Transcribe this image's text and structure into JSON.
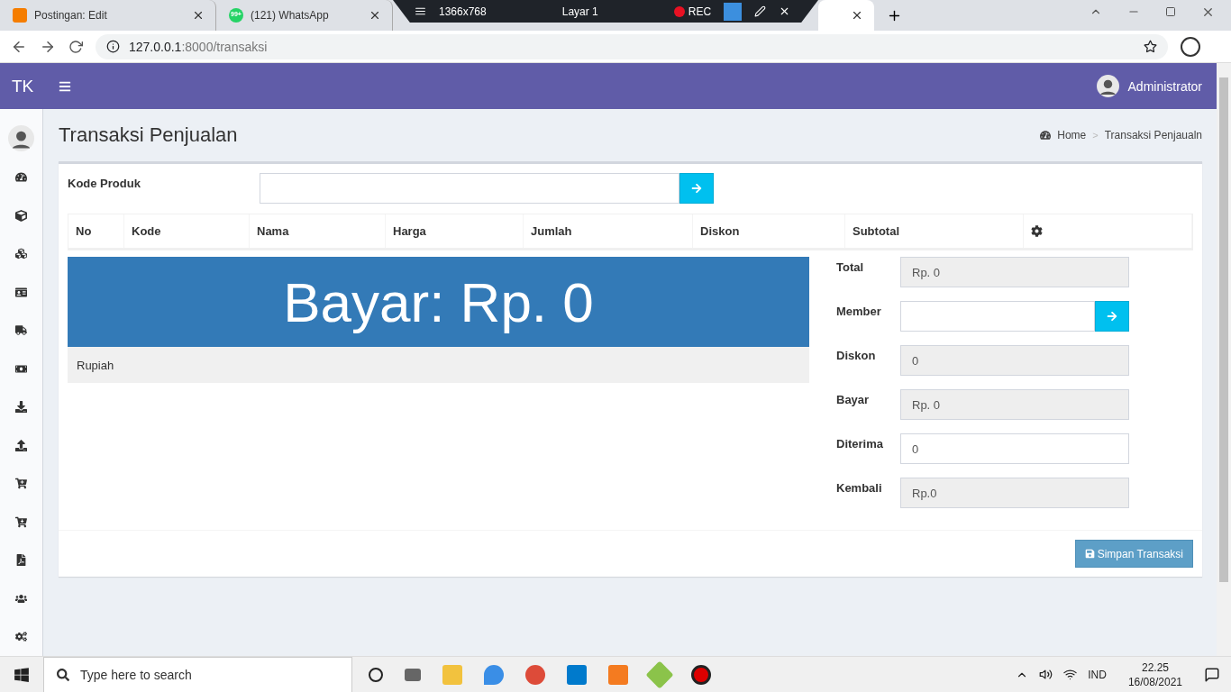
{
  "browser": {
    "tabs": [
      {
        "title": "Postingan: Edit",
        "selected": false
      },
      {
        "title": "(121) WhatsApp",
        "badge": "99+",
        "selected": false
      },
      {
        "selected": true
      }
    ],
    "recorder": {
      "resolution": "1366x768",
      "layer": "Layar 1",
      "rec": "REC"
    },
    "url": {
      "host": "127.0.0.1",
      "rest": ":8000/transaksi"
    }
  },
  "app": {
    "brand": "TK",
    "user": "Administrator"
  },
  "page": {
    "title": "Transaksi Penjualan",
    "breadcrumb": [
      "Home",
      "Transaksi Penjaualn"
    ],
    "breadcrumb_separator": ">"
  },
  "form": {
    "label": "Kode Produk"
  },
  "table": {
    "columns": [
      "No",
      "Kode",
      "Nama",
      "Harga",
      "Jumlah",
      "Diskon",
      "Subtotal"
    ]
  },
  "pay": {
    "banner": "Bayar: Rp. 0",
    "note": "Rupiah"
  },
  "summary": [
    {
      "label": "Total",
      "value": "Rp. 0",
      "kind": "readonly"
    },
    {
      "label": "Member",
      "kind": "lookup"
    },
    {
      "label": "Diskon",
      "value": "0",
      "kind": "readonly"
    },
    {
      "label": "Bayar",
      "value": "Rp. 0",
      "kind": "readonly"
    },
    {
      "label": "Diterima",
      "value": "0",
      "kind": "input"
    },
    {
      "label": "Kembali",
      "value": "Rp.0",
      "kind": "readonly"
    }
  ],
  "save_button": "Simpan Transaksi",
  "taskbar": {
    "search_placeholder": "Type here to search",
    "language": "IND",
    "time": "22.25",
    "date": "16/08/2021"
  }
}
